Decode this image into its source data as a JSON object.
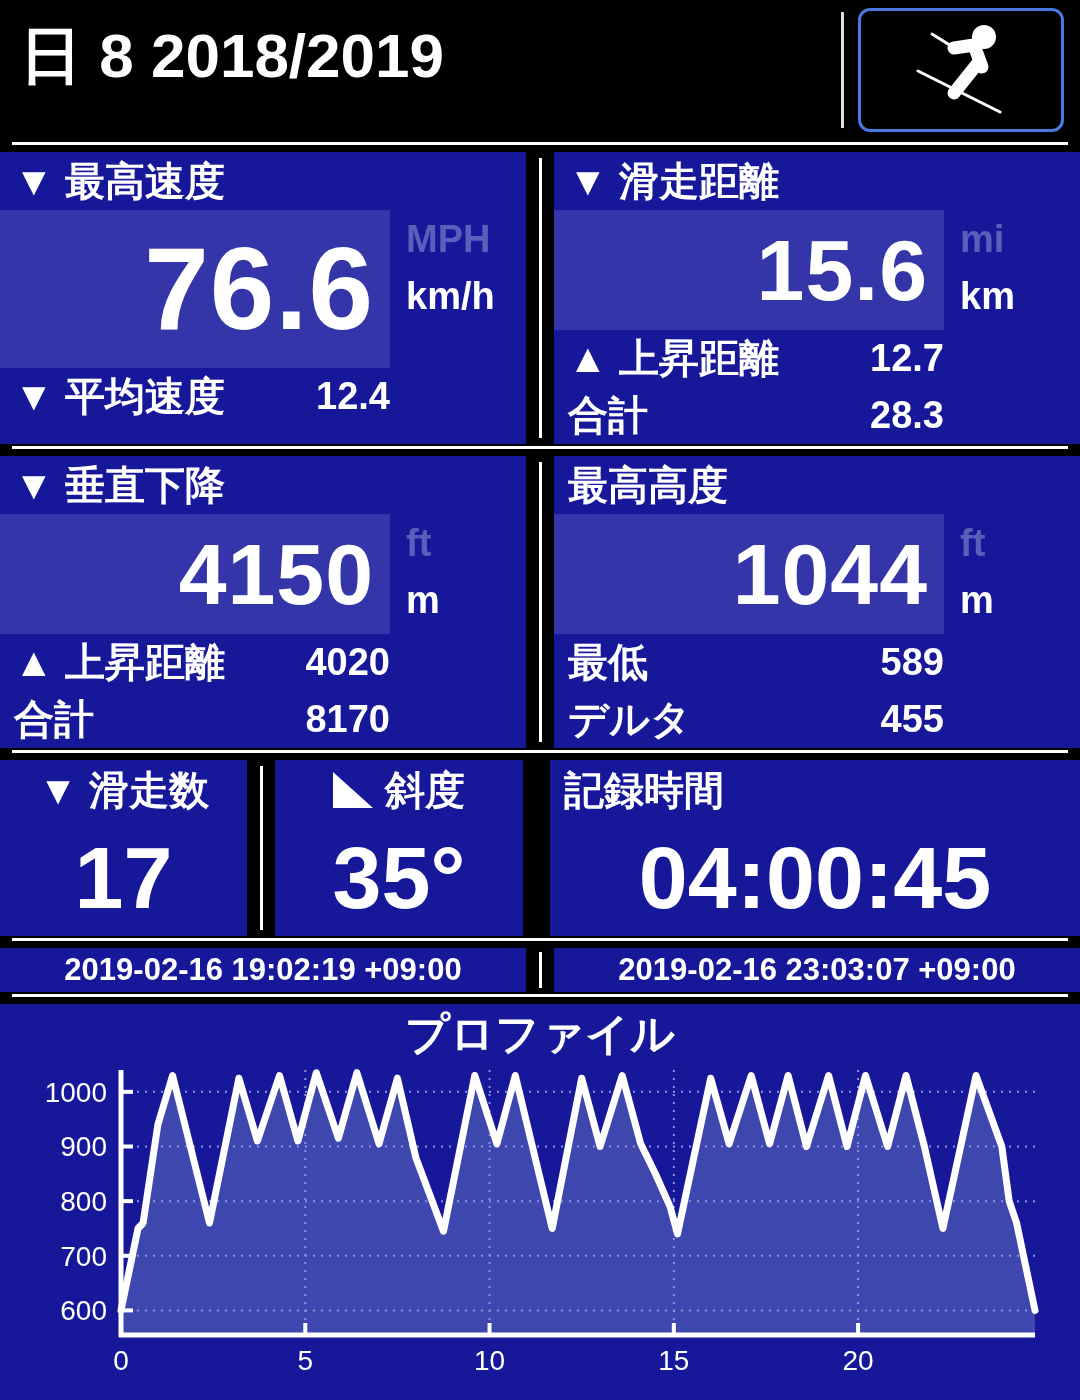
{
  "header": {
    "title": "日 8 2018/2019"
  },
  "panels": [
    {
      "title": "▼ 最高速度",
      "value": "76.6",
      "units": [
        {
          "label": "MPH",
          "selected": false
        },
        {
          "label": "km/h",
          "selected": true
        }
      ],
      "rows": [
        {
          "label": "▼ 平均速度",
          "value": "12.4"
        }
      ]
    },
    {
      "title": "▼ 滑走距離",
      "value": "15.6",
      "units": [
        {
          "label": "mi",
          "selected": false
        },
        {
          "label": "km",
          "selected": true
        }
      ],
      "rows": [
        {
          "label": "▲ 上昇距離",
          "value": "12.7"
        },
        {
          "label": "合計",
          "value": "28.3"
        }
      ]
    },
    {
      "title": "▼ 垂直下降",
      "value": "4150",
      "units": [
        {
          "label": "ft",
          "selected": false
        },
        {
          "label": "m",
          "selected": true
        }
      ],
      "rows": [
        {
          "label": "▲ 上昇距離",
          "value": "4020"
        },
        {
          "label": "合計",
          "value": "8170"
        }
      ]
    },
    {
      "title": "最高高度",
      "value": "1044",
      "units": [
        {
          "label": "ft",
          "selected": false
        },
        {
          "label": "m",
          "selected": true
        }
      ],
      "rows": [
        {
          "label": "最低",
          "value": "589"
        },
        {
          "label": "デルタ",
          "value": "455"
        }
      ]
    }
  ],
  "stats": [
    {
      "kind": "count",
      "title": "▼ 滑走数",
      "value": "17"
    },
    {
      "kind": "slope",
      "title": "斜度",
      "value": "35°"
    },
    {
      "kind": "time",
      "title": "記録時間",
      "value": "04:00:45"
    }
  ],
  "timestamps": [
    "2019-02-16 19:02:19 +09:00",
    "2019-02-16 23:03:07 +09:00"
  ],
  "profile": {
    "title": "プロファイル",
    "chart_data": {
      "type": "area",
      "grid": true,
      "xlim": [
        0,
        24.8
      ],
      "ylim": [
        555,
        1040
      ],
      "xticks": [
        0,
        5,
        10,
        15,
        20
      ],
      "yticks": [
        600,
        700,
        800,
        900,
        1000
      ],
      "x": [
        0,
        0.46,
        0.6,
        1.0,
        1.4,
        2.4,
        3.2,
        3.7,
        4.3,
        4.8,
        5.3,
        5.9,
        6.4,
        7.0,
        7.5,
        8.0,
        8.75,
        9.6,
        10.2,
        10.7,
        11.7,
        12.5,
        13.0,
        13.6,
        14.1,
        14.5,
        14.9,
        15.1,
        16.0,
        16.5,
        17.1,
        17.6,
        18.1,
        18.6,
        19.2,
        19.7,
        20.2,
        20.8,
        21.3,
        21.8,
        22.3,
        23.2,
        23.9,
        24.1,
        24.3,
        24.8
      ],
      "series": [
        {
          "color": "#ffffff",
          "values": [
            600,
            750,
            760,
            940,
            1030,
            760,
            1025,
            910,
            1030,
            910,
            1035,
            915,
            1035,
            905,
            1025,
            880,
            745,
            1030,
            905,
            1030,
            750,
            1025,
            900,
            1030,
            905,
            850,
            790,
            740,
            1025,
            905,
            1030,
            905,
            1030,
            900,
            1030,
            900,
            1030,
            900,
            1030,
            900,
            750,
            1030,
            900,
            800,
            760,
            600
          ]
        }
      ]
    }
  }
}
